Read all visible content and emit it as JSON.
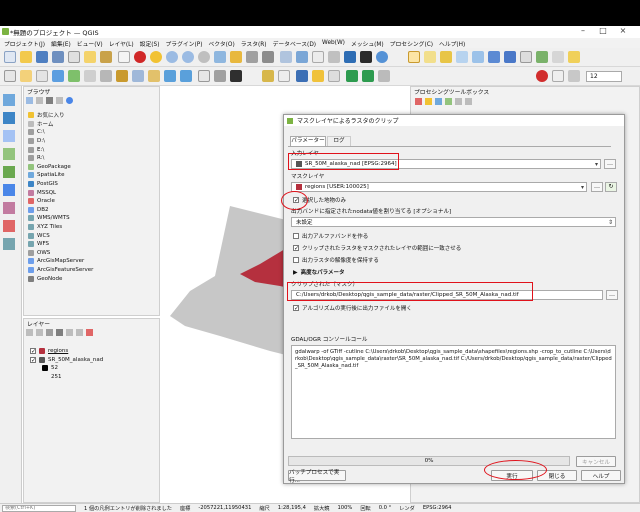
{
  "window": {
    "title": "*無題のプロジェクト — QGIS"
  },
  "menu": [
    "プロジェクト(J)",
    "編集(E)",
    "ビュー(V)",
    "レイヤ(L)",
    "設定(S)",
    "プラグイン(P)",
    "ベクタ(O)",
    "ラスタ(R)",
    "データベース(D)",
    "Web(W)",
    "メッシュ(M)",
    "プロセシング(C)",
    "ヘルプ(H)"
  ],
  "toolbar": {
    "scale_value": "12"
  },
  "browser": {
    "title": "ブラウザ",
    "items": [
      "お気に入り",
      "ホーム",
      "C:\\",
      "D:\\",
      "E:\\",
      "R:\\",
      "GeoPackage",
      "SpatiaLite",
      "PostGIS",
      "MSSQL",
      "Oracle",
      "DB2",
      "WMS/WMTS",
      "XYZ Tiles",
      "WCS",
      "WFS",
      "OWS",
      "ArcGisMapServer",
      "ArcGisFeatureServer",
      "GeoNode"
    ]
  },
  "layers": {
    "title": "レイヤー",
    "items": [
      "regions",
      "SR_50M_alaska_nad"
    ],
    "legend": [
      "52",
      "251"
    ]
  },
  "toolbox": {
    "title": "プロセシングツールボックス"
  },
  "dialog": {
    "title": "マスクレイヤによるラスタのクリップ",
    "tab_params": "パラメーター",
    "tab_log": "ログ",
    "input_label": "入力レイヤ",
    "input_value": "SR_50M_alaska_nad [EPSG:2964]",
    "mask_label": "マスクレイヤ",
    "mask_value": "regions [USER:100025]",
    "selected_only": "選択した地物のみ",
    "nodata_label": "出力バンドに指定されたnodata値を割り当てる [オプショナル]",
    "nodata_value": "未設定",
    "alpha_band": "出力アルファバンドを作る",
    "crop_to_cutline": "クリップされたラスタをマスクされたレイヤの範囲に一致させる",
    "keep_resolution": "出力ラスタの解像度を保持する",
    "advanced": "高度なパラメータ",
    "output_label": "クリップされた（マスク）",
    "output_value": "C:/Users/drkob/Desktop/qgis_sample_data/raster/Clipped_SR_50M_Alaska_nad.tif",
    "open_after": "アルゴリズムの実行後に出力ファイルを開く",
    "console_label": "GDAL/OGR コンソールコール",
    "console_text": "gdalwarp -of GTiff -cutline C:\\Users\\drkob\\Desktop\\qgis_sample_data\\shapefiles\\regions.shp -crop_to_cutline C:\\Users\\drkob\\Desktop\\qgis_sample_data\\raster\\SR_50M_alaska_nad.tif C:/Users/drkob/Desktop/qgis_sample_data/raster/Clipped_SR_50M_Alaska_nad.tif",
    "progress": "0%",
    "progress_value": 0,
    "cancel": "キャンセル",
    "batch": "バッチプロセスで実行...",
    "run": "実行",
    "close": "閉じる",
    "help": "ヘルプ"
  },
  "status": {
    "search_placeholder": "検索(Ctrl+K)",
    "message": "1 個の凡例エントリが削除されました",
    "coord_label": "座標",
    "coord": "-2057221,11950431",
    "scale_label": "縮尺",
    "scale": "1:28,195,4",
    "magnifier_label": "拡大鏡",
    "magnifier": "100%",
    "rotation_label": "回転",
    "rotation": "0.0 °",
    "render": "レンダ",
    "crs": "EPSG:2964"
  },
  "colors": {
    "accent_red": "#e0121b",
    "region_red": "#b5303e",
    "clip_yellow": "#ffff00"
  }
}
